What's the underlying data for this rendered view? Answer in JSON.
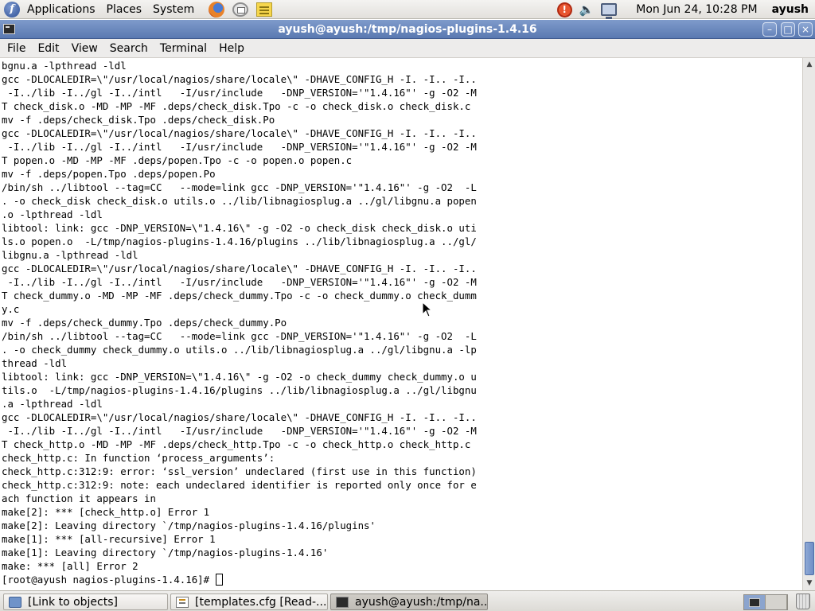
{
  "top_panel": {
    "menus": [
      "Applications",
      "Places",
      "System"
    ],
    "launchers": [
      "firefox-icon",
      "mail-clock-icon",
      "notes-icon"
    ],
    "tray": [
      "update-alert-icon",
      "volume-icon",
      "network-icon"
    ],
    "clock": "Mon Jun 24, 10:28 PM",
    "user": "ayush"
  },
  "window": {
    "title": "ayush@ayush:/tmp/nagios-plugins-1.4.16",
    "buttons": [
      "minimize",
      "maximize",
      "close"
    ]
  },
  "menubar": {
    "items": [
      "File",
      "Edit",
      "View",
      "Search",
      "Terminal",
      "Help"
    ]
  },
  "terminal": {
    "lines": [
      "bgnu.a -lpthread -ldl",
      "gcc -DLOCALEDIR=\\\"/usr/local/nagios/share/locale\\\" -DHAVE_CONFIG_H -I. -I.. -I..",
      " -I../lib -I../gl -I../intl   -I/usr/include   -DNP_VERSION='\"1.4.16\"' -g -O2 -M",
      "T check_disk.o -MD -MP -MF .deps/check_disk.Tpo -c -o check_disk.o check_disk.c",
      "mv -f .deps/check_disk.Tpo .deps/check_disk.Po",
      "gcc -DLOCALEDIR=\\\"/usr/local/nagios/share/locale\\\" -DHAVE_CONFIG_H -I. -I.. -I..",
      " -I../lib -I../gl -I../intl   -I/usr/include   -DNP_VERSION='\"1.4.16\"' -g -O2 -M",
      "T popen.o -MD -MP -MF .deps/popen.Tpo -c -o popen.o popen.c",
      "mv -f .deps/popen.Tpo .deps/popen.Po",
      "/bin/sh ../libtool --tag=CC   --mode=link gcc -DNP_VERSION='\"1.4.16\"' -g -O2  -L",
      ". -o check_disk check_disk.o utils.o ../lib/libnagiosplug.a ../gl/libgnu.a popen",
      ".o -lpthread -ldl",
      "libtool: link: gcc -DNP_VERSION=\\\"1.4.16\\\" -g -O2 -o check_disk check_disk.o uti",
      "ls.o popen.o  -L/tmp/nagios-plugins-1.4.16/plugins ../lib/libnagiosplug.a ../gl/",
      "libgnu.a -lpthread -ldl",
      "gcc -DLOCALEDIR=\\\"/usr/local/nagios/share/locale\\\" -DHAVE_CONFIG_H -I. -I.. -I..",
      " -I../lib -I../gl -I../intl   -I/usr/include   -DNP_VERSION='\"1.4.16\"' -g -O2 -M",
      "T check_dummy.o -MD -MP -MF .deps/check_dummy.Tpo -c -o check_dummy.o check_dumm",
      "y.c",
      "mv -f .deps/check_dummy.Tpo .deps/check_dummy.Po",
      "/bin/sh ../libtool --tag=CC   --mode=link gcc -DNP_VERSION='\"1.4.16\"' -g -O2  -L",
      ". -o check_dummy check_dummy.o utils.o ../lib/libnagiosplug.a ../gl/libgnu.a -lp",
      "thread -ldl",
      "libtool: link: gcc -DNP_VERSION=\\\"1.4.16\\\" -g -O2 -o check_dummy check_dummy.o u",
      "tils.o  -L/tmp/nagios-plugins-1.4.16/plugins ../lib/libnagiosplug.a ../gl/libgnu",
      ".a -lpthread -ldl",
      "gcc -DLOCALEDIR=\\\"/usr/local/nagios/share/locale\\\" -DHAVE_CONFIG_H -I. -I.. -I..",
      " -I../lib -I../gl -I../intl   -I/usr/include   -DNP_VERSION='\"1.4.16\"' -g -O2 -M",
      "T check_http.o -MD -MP -MF .deps/check_http.Tpo -c -o check_http.o check_http.c",
      "check_http.c: In function ‘process_arguments’:",
      "check_http.c:312:9: error: ‘ssl_version’ undeclared (first use in this function)",
      "check_http.c:312:9: note: each undeclared identifier is reported only once for e",
      "ach function it appears in",
      "make[2]: *** [check_http.o] Error 1",
      "make[2]: Leaving directory `/tmp/nagios-plugins-1.4.16/plugins'",
      "make[1]: *** [all-recursive] Error 1",
      "make[1]: Leaving directory `/tmp/nagios-plugins-1.4.16'",
      "make: *** [all] Error 2"
    ],
    "prompt": "[root@ayush nagios-plugins-1.4.16]# ",
    "scroll_position": 1.0
  },
  "taskbar": {
    "tasks": [
      {
        "label": "[Link to objects]",
        "icon": "folder-icon",
        "active": false
      },
      {
        "label": "[templates.cfg [Read-...",
        "icon": "text-editor-icon",
        "active": false
      },
      {
        "label": "ayush@ayush:/tmp/na...",
        "icon": "terminal-icon",
        "active": true
      }
    ],
    "workspaces": 2,
    "current_workspace": 1,
    "trash": "trash-icon"
  }
}
